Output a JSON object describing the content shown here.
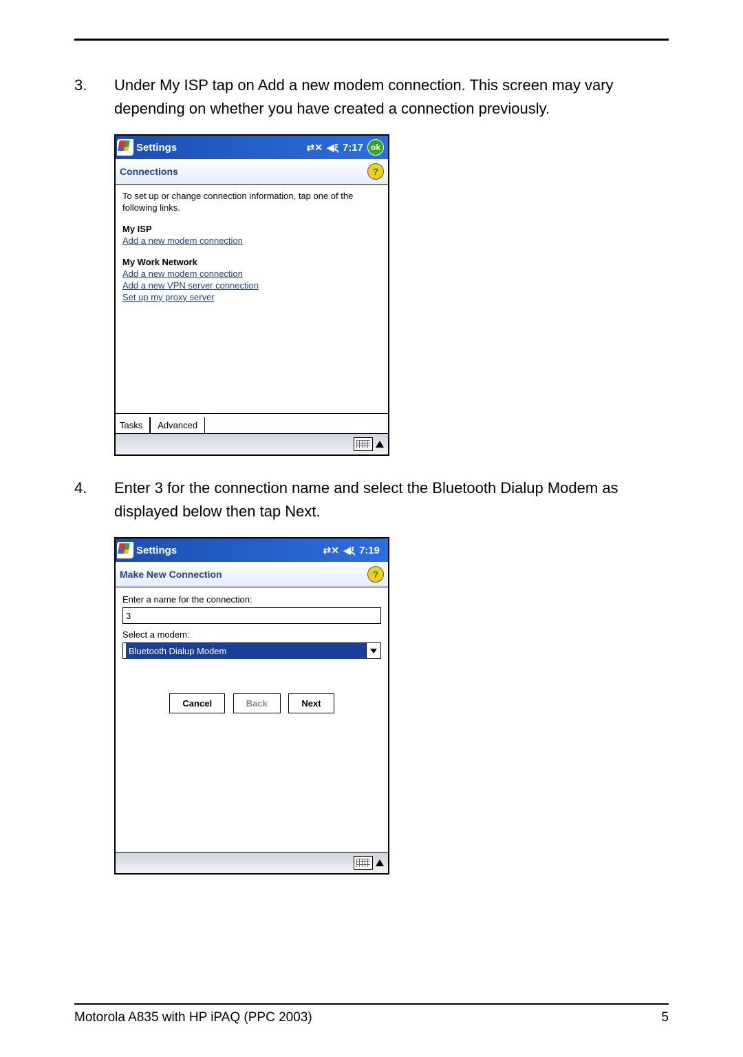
{
  "steps": {
    "s3": {
      "num": "3.",
      "text": "Under My ISP tap on Add a new modem connection. This screen may vary depending on whether you have created a connection previously."
    },
    "s4": {
      "num": "4.",
      "text": "Enter 3 for the connection name and select the Bluetooth Dialup Modem as displayed below then tap Next."
    }
  },
  "screen1": {
    "titlebar": {
      "title": "Settings",
      "time": "7:17",
      "ok": "ok"
    },
    "pane_title": "Connections",
    "help_glyph": "?",
    "intro": "To set up or change connection information, tap one of the following links.",
    "isp_header": "My ISP",
    "isp_link": "Add a new modem connection",
    "work_header": "My Work Network",
    "work_links": {
      "l1": "Add a new modem connection",
      "l2": "Add a new VPN server connection",
      "l3": "Set up my proxy server"
    },
    "tabs": {
      "active": "Tasks",
      "other": "Advanced"
    }
  },
  "screen2": {
    "titlebar": {
      "title": "Settings",
      "time": "7:19"
    },
    "pane_title": "Make New Connection",
    "help_glyph": "?",
    "name_label": "Enter a name for the connection:",
    "name_value": "3",
    "modem_label": "Select a modem:",
    "modem_value": "Bluetooth Dialup Modem",
    "buttons": {
      "cancel": "Cancel",
      "back": "Back",
      "next": "Next"
    }
  },
  "footer": {
    "left": "Motorola A835 with HP iPAQ (PPC 2003)",
    "right": "5"
  },
  "icons": {
    "conn": "⇄✕",
    "vol": "◀ξ"
  }
}
